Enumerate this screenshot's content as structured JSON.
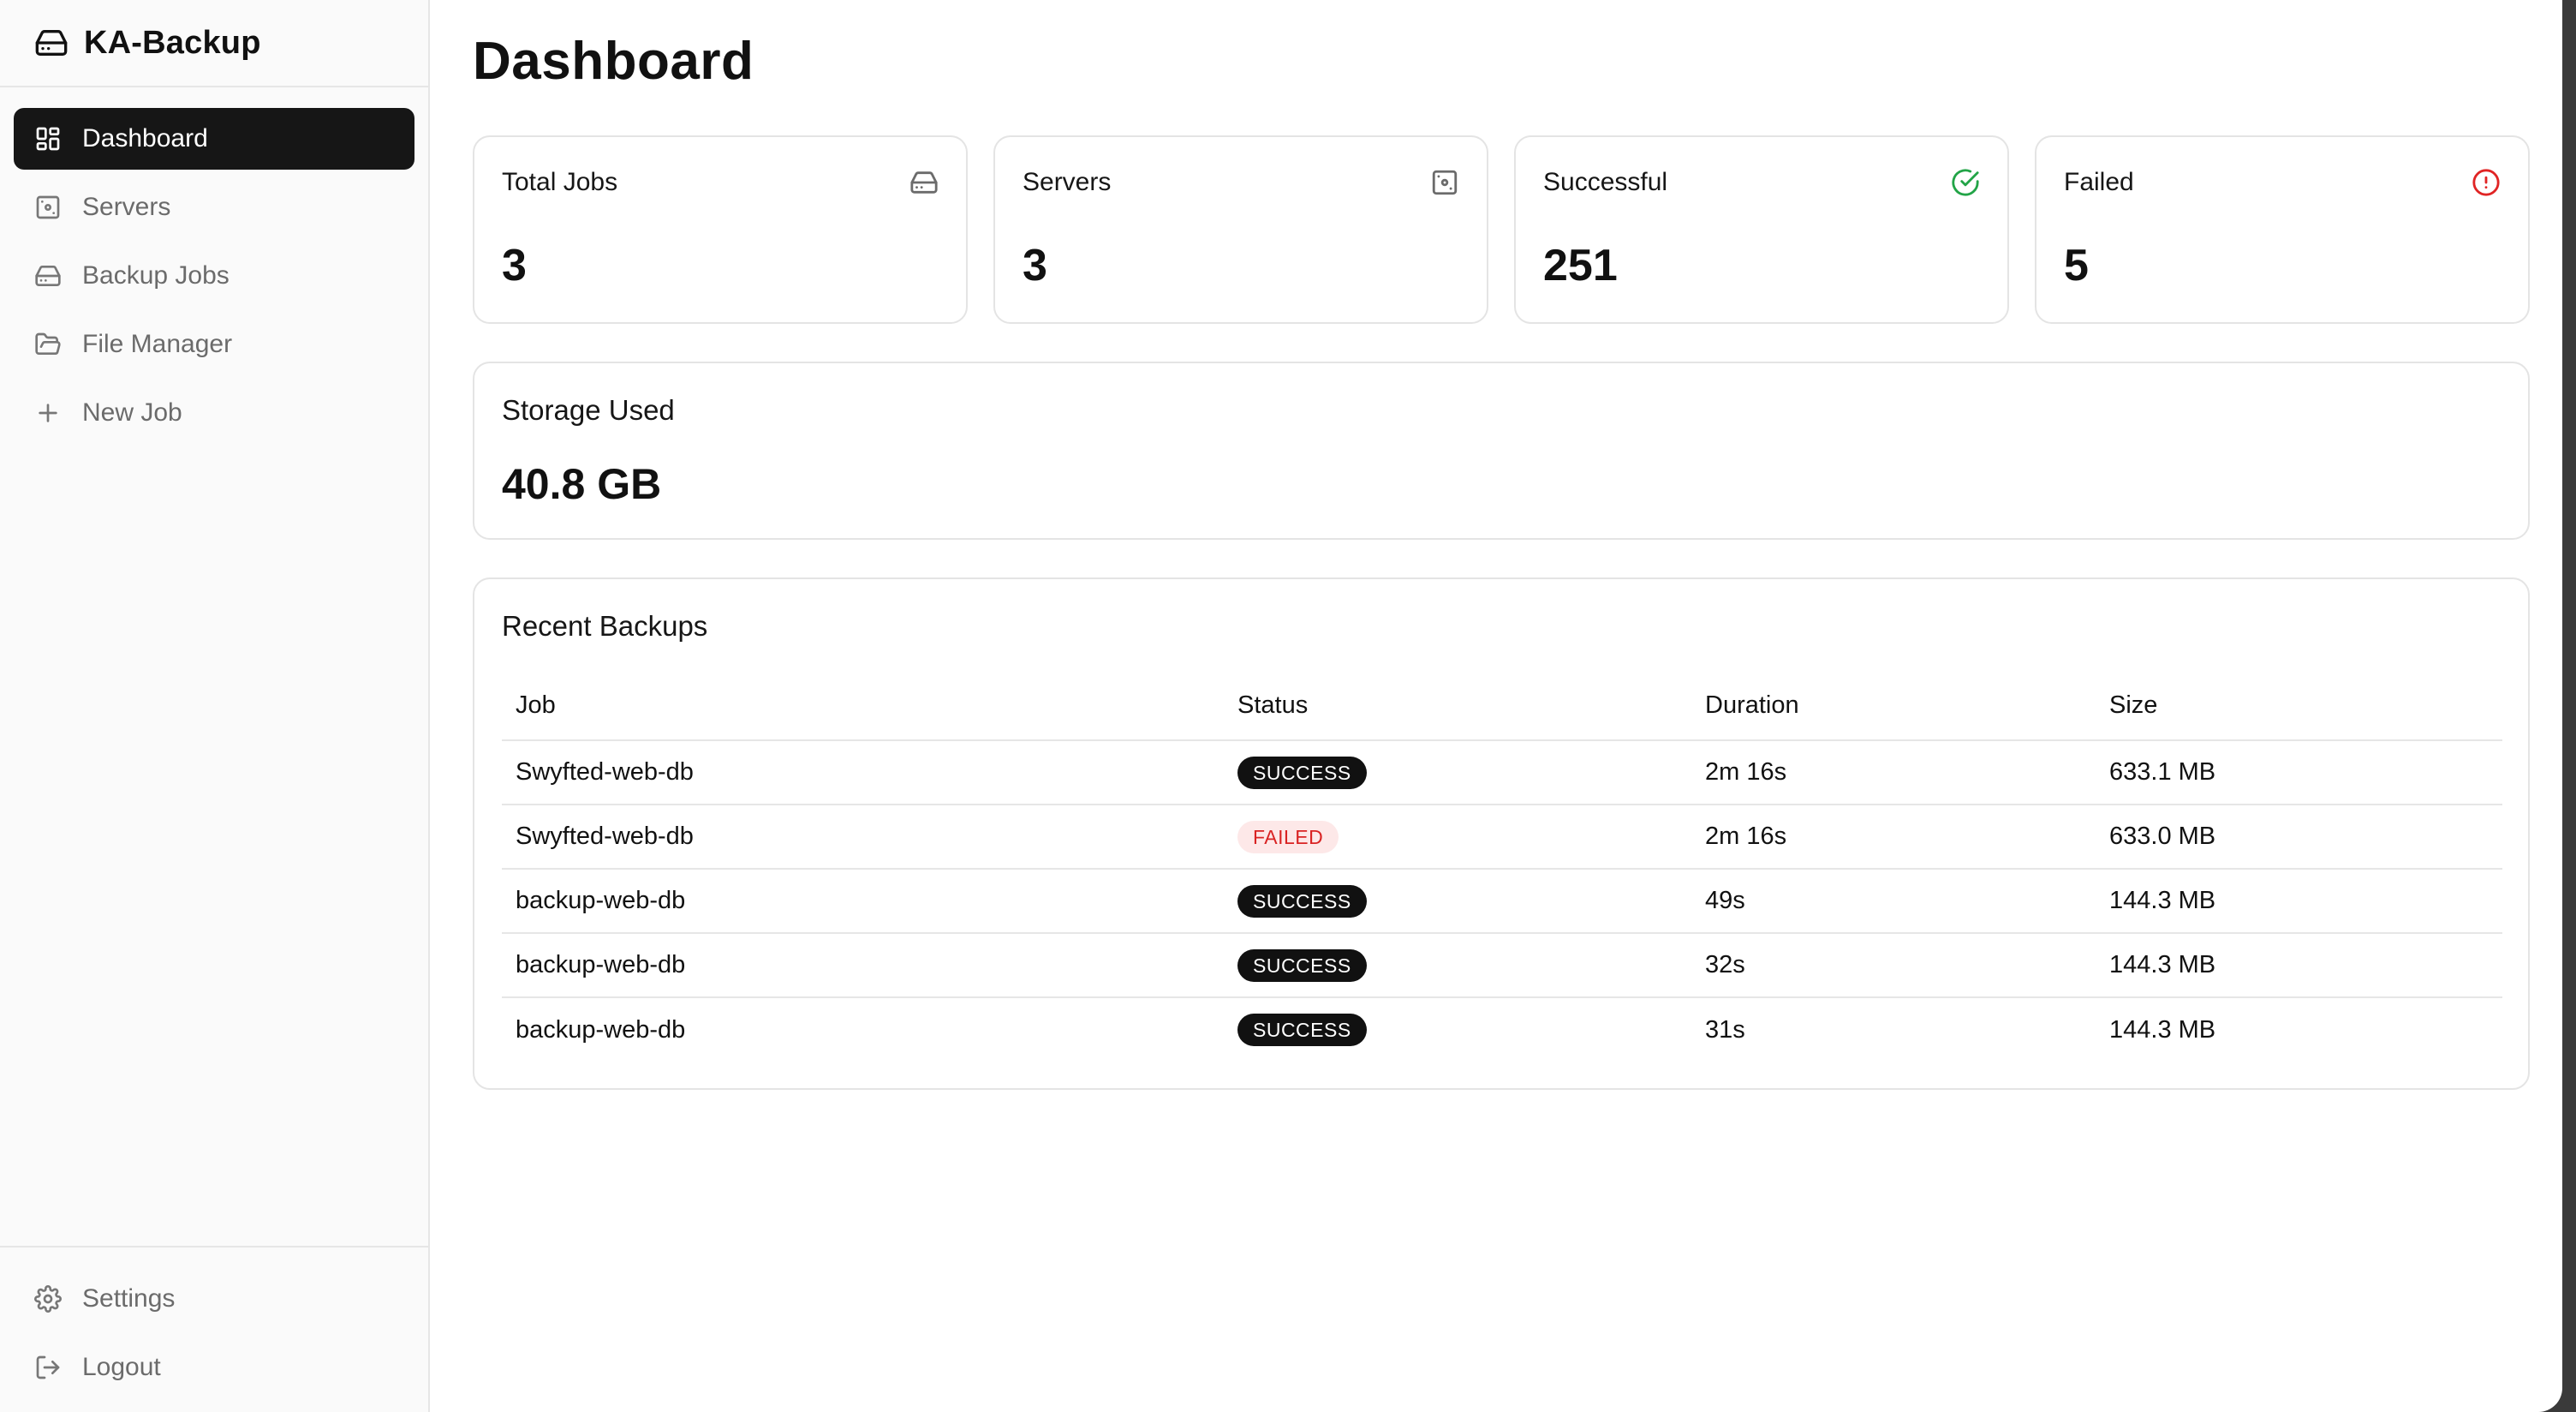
{
  "app": {
    "title": "KA-Backup"
  },
  "sidebar": {
    "items": [
      {
        "label": "Dashboard",
        "icon": "dashboard-grid-icon",
        "active": true
      },
      {
        "label": "Servers",
        "icon": "server-icon",
        "active": false
      },
      {
        "label": "Backup Jobs",
        "icon": "hard-drive-icon",
        "active": false
      },
      {
        "label": "File Manager",
        "icon": "folder-open-icon",
        "active": false
      },
      {
        "label": "New Job",
        "icon": "plus-icon",
        "active": false
      }
    ],
    "bottom": [
      {
        "label": "Settings",
        "icon": "gear-icon"
      },
      {
        "label": "Logout",
        "icon": "logout-icon"
      }
    ]
  },
  "main": {
    "title": "Dashboard",
    "stats": [
      {
        "label": "Total Jobs",
        "value": "3",
        "icon": "hard-drive-icon",
        "color": "#6b6b6b"
      },
      {
        "label": "Servers",
        "value": "3",
        "icon": "server-icon",
        "color": "#6b6b6b"
      },
      {
        "label": "Successful",
        "value": "251",
        "icon": "check-circle-icon",
        "color": "#22a447"
      },
      {
        "label": "Failed",
        "value": "5",
        "icon": "alert-circle-icon",
        "color": "#e02424"
      }
    ],
    "storage": {
      "label": "Storage Used",
      "value": "40.8 GB"
    },
    "recent": {
      "title": "Recent Backups",
      "columns": [
        "Job",
        "Status",
        "Duration",
        "Size"
      ],
      "rows": [
        {
          "job": "Swyfted-web-db",
          "status": "SUCCESS",
          "duration": "2m 16s",
          "size": "633.1 MB"
        },
        {
          "job": "Swyfted-web-db",
          "status": "FAILED",
          "duration": "2m 16s",
          "size": "633.0 MB"
        },
        {
          "job": "backup-web-db",
          "status": "SUCCESS",
          "duration": "49s",
          "size": "144.3 MB"
        },
        {
          "job": "backup-web-db",
          "status": "SUCCESS",
          "duration": "32s",
          "size": "144.3 MB"
        },
        {
          "job": "backup-web-db",
          "status": "SUCCESS",
          "duration": "31s",
          "size": "144.3 MB"
        }
      ]
    }
  }
}
